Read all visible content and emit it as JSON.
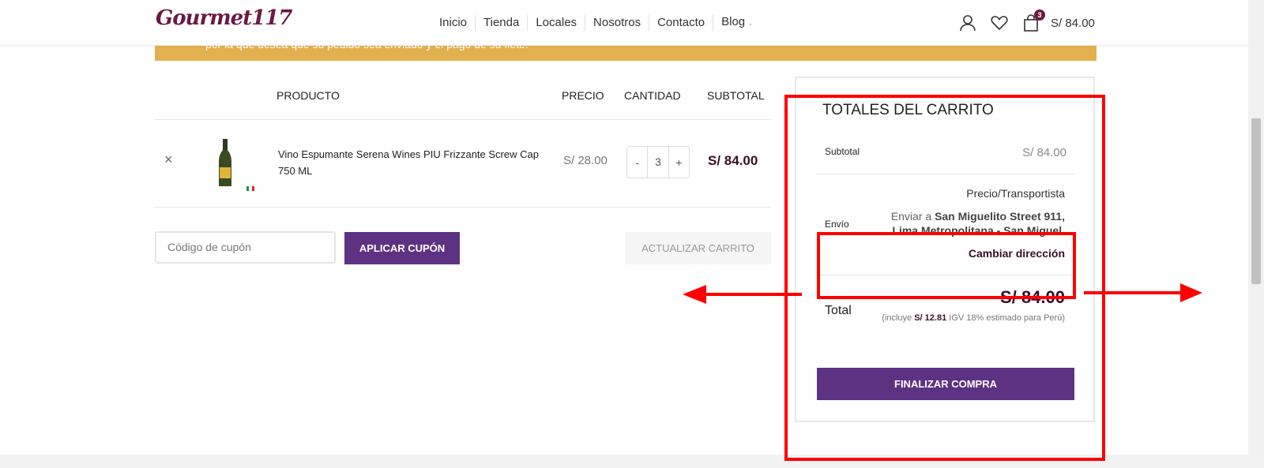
{
  "header": {
    "logo": "Gourmet117",
    "nav": [
      "Inicio",
      "Tienda",
      "Locales",
      "Nosotros",
      "Contacto",
      "Blog"
    ],
    "cart_count": "3",
    "cart_total": "S/ 84.00"
  },
  "notice": {
    "text": "por la que desea que su pedido sea enviado y el pago de su flete."
  },
  "table": {
    "headers": {
      "product": "PRODUCTO",
      "price": "PRECIO",
      "quantity": "CANTIDAD",
      "subtotal": "SUBTOTAL"
    },
    "rows": [
      {
        "remove": "×",
        "name": "Vino Espumante Serena Wines PIU Frizzante Screw Cap 750 ML",
        "price": "S/ 28.00",
        "qty_minus": "-",
        "quantity": "3",
        "qty_plus": "+",
        "subtotal": "S/ 84.00"
      }
    ]
  },
  "coupon": {
    "placeholder": "Código de cupón",
    "apply_label": "APLICAR CUPÓN",
    "update_label": "ACTUALIZAR CARRITO"
  },
  "totals": {
    "title": "TOTALES DEL CARRITO",
    "subtotal_label": "Subtotal",
    "subtotal_value": "S/ 84.00",
    "shipping_label": "Envío",
    "shipping_method": "Precio/Transportista",
    "ship_prefix": "Enviar a ",
    "ship_address": "San Miguelito Street 911, Lima Metropolitana - San Miguel.",
    "change_address": "Cambiar dirección",
    "total_label": "Total",
    "total_value": "S/ 84.00",
    "tax_prefix": "(incluye ",
    "tax_amount": "S/ 12.81",
    "tax_suffix": " IGV 18% estimado para Perú)",
    "checkout_label": "FINALIZAR COMPRA"
  },
  "colors": {
    "brand": "#6a1a44",
    "button": "#5e3283",
    "notice": "#e2b04f",
    "annotation": "#ff0000"
  }
}
